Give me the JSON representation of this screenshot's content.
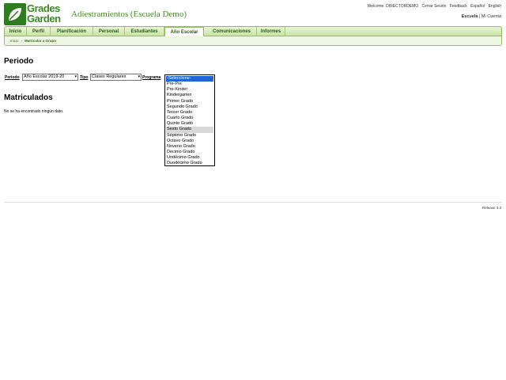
{
  "header": {
    "logo_line1": "Grades",
    "logo_line2": "Garden",
    "school_title": "Adiestramientos (Escuela Demo)",
    "welcome": "Welcome: DIRECTORDEMO",
    "logout": "Cerrar Sesión",
    "feedback": "Feedback",
    "lang_es": "Español",
    "lang_en": "English",
    "escuela": "Escuela",
    "separator": "|",
    "mi_cuenta": "Mi Cuenta"
  },
  "nav": {
    "items": [
      {
        "label": "Inicio"
      },
      {
        "label": "Perfil"
      },
      {
        "label": "Planificación"
      },
      {
        "label": "Personal"
      },
      {
        "label": "Estudiantes"
      },
      {
        "label": "Año Escolar"
      },
      {
        "label": "Comunicaciones"
      },
      {
        "label": "Informes"
      }
    ],
    "active": "Año Escolar"
  },
  "breadcrumb": {
    "home": "Inicio",
    "sep": "›",
    "current": "Matricular a Grupo"
  },
  "periodo": {
    "heading": "Periodo",
    "periodo_label": "Periodo",
    "periodo_value": "Año Escolar 2019-20",
    "tipo_label": "Tipo",
    "tipo_value": "Clases Regulares",
    "programa_label": "Programa"
  },
  "programa_options": [
    "-Seleccione-",
    "Pre-Pre",
    "Pre-Kinder",
    "Kindergarten",
    "Primer Grado",
    "Segundo Grado",
    "Tercer Grado",
    "Cuarto Grado",
    "Quinto Grado",
    "Sexto Grado",
    "Séptimo Grado",
    "Octavo Grado",
    "Noveno Grado",
    "Decimo Grado",
    "Undécimo Grado",
    "Duodécimo Grado"
  ],
  "programa_selected": "-Seleccione-",
  "programa_hovered": "Sexto Grado",
  "matriculados": {
    "heading": "Matriculados",
    "no_data": "No se ha encontrado ningún dato."
  },
  "footer": {
    "release": "Release 3.3"
  },
  "colors": {
    "brand_green": "#3a8a24",
    "nav_border": "#8fbf61",
    "selected_option": "#1e66d8"
  }
}
